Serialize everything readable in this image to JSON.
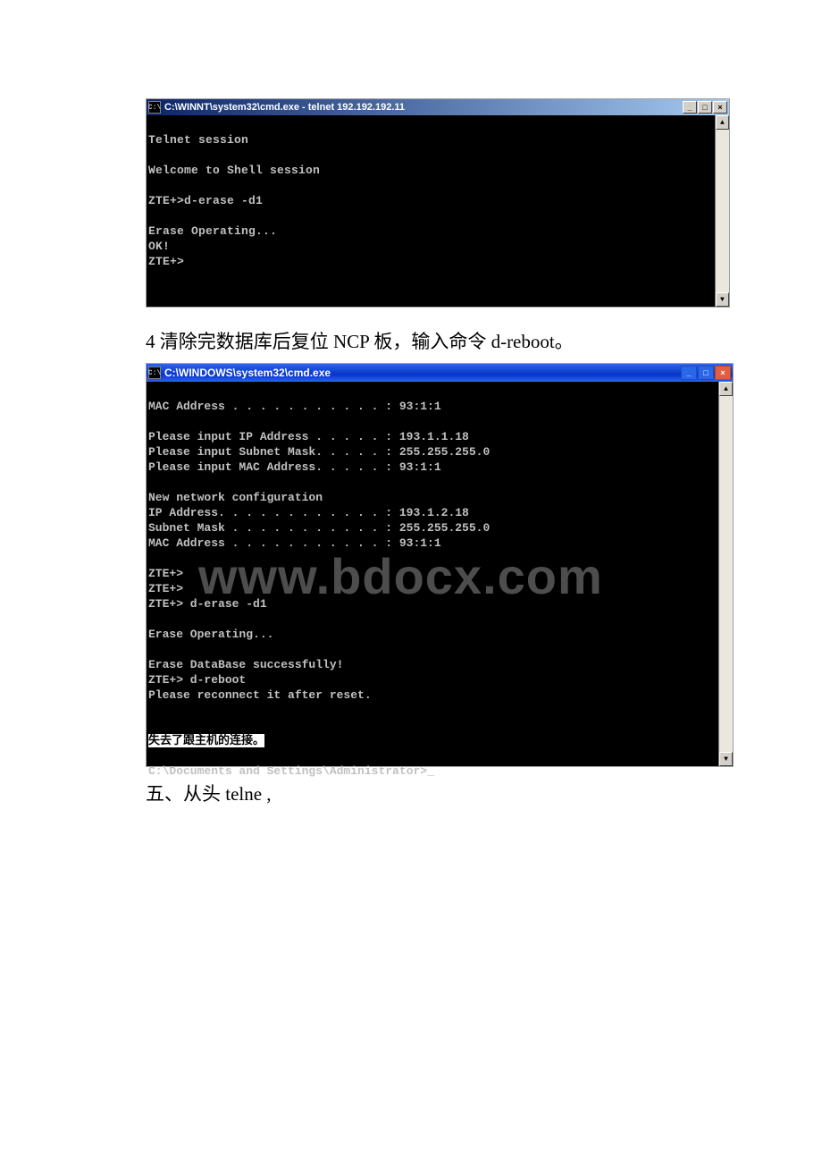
{
  "window1": {
    "icon_label": "C:\\",
    "title": "C:\\WINNT\\system32\\cmd.exe - telnet 192.192.192.11",
    "min_label": "_",
    "max_label": "□",
    "close_label": "×",
    "scroll_up": "▲",
    "scroll_down": "▼",
    "lines": "\nTelnet session\n\nWelcome to Shell session\n\nZTE+>d-erase -d1\n\nErase Operating...\nOK!\nZTE+>"
  },
  "paragraph1": "4 清除完数据库后复位 NCP 板，输入命令 d-reboot。",
  "window2": {
    "icon_label": "C:\\",
    "title": "C:\\WINDOWS\\system32\\cmd.exe",
    "min_label": "_",
    "max_label": "□",
    "close_label": "×",
    "scroll_up": "▲",
    "scroll_down": "▼",
    "line01": "MAC Address . . . . . . . . . . . : 93:1:1",
    "line02": "",
    "line03": "Please input IP Address . . . . . : 193.1.1.18",
    "line04": "Please input Subnet Mask. . . . . : 255.255.255.0",
    "line05": "Please input MAC Address. . . . . : 93:1:1",
    "line06": "",
    "line07": "New network configuration",
    "line08": "IP Address. . . . . . . . . . . . : 193.1.2.18",
    "line09": "Subnet Mask . . . . . . . . . . . : 255.255.255.0",
    "line10": "MAC Address . . . . . . . . . . . : 93:1:1",
    "line11": "",
    "line12": "ZTE+>",
    "line13": "ZTE+>",
    "line14": "ZTE+> d-erase -d1",
    "line15": "",
    "line16": "Erase Operating...",
    "line17": "",
    "line18": "Erase DataBase successfully!",
    "line19": "ZTE+> d-reboot",
    "line20": "Please reconnect it after reset.",
    "line21": "",
    "line22": "",
    "line23_hl": "失去了跟主机的连接。",
    "line24": "",
    "line25": "C:\\Documents and Settings\\Administrator>"
  },
  "watermark": "www.bdocx.com",
  "paragraph2": "五、从头 telne ,"
}
